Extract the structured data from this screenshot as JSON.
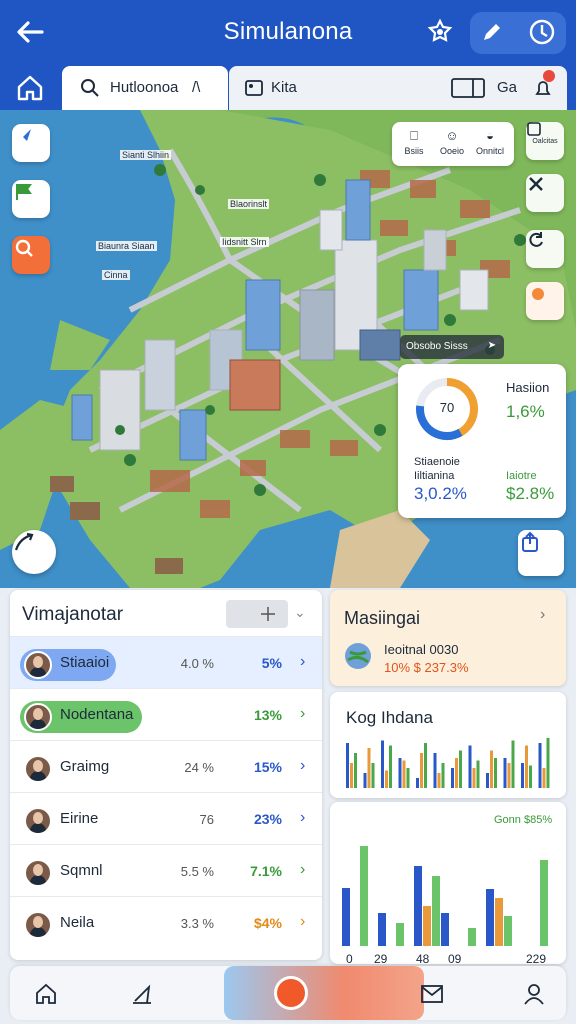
{
  "header": {
    "title": "Simulanona",
    "icons": [
      "back-arrow-icon",
      "settings-star-icon",
      "pencil-icon",
      "clock-icon"
    ]
  },
  "tabs": [
    {
      "label": "Hutloonoa",
      "icon": "search-icon",
      "suffix": "/\\"
    },
    {
      "label": "Kita",
      "icon": "image-icon",
      "right_label": "Ga"
    }
  ],
  "map": {
    "labels": [
      "Sianti Slhiin",
      "Blaorinslt",
      "Biaunra Siaan",
      "Iidsnitt Slrn",
      "Cinna"
    ],
    "toolbar": [
      {
        "label": "Bsiis",
        "icon": "bookmark-icon"
      },
      {
        "label": "Ooeio",
        "icon": "smile-icon"
      },
      {
        "label": "Onnitcl",
        "icon": "bell-icon"
      }
    ],
    "right_buttons": [
      "Oalcitas"
    ],
    "pin_label": "Obsobo Sisss",
    "stat_card": {
      "ring_value": "70",
      "top_label": "Hasiion",
      "top_value": "1,6%",
      "left_label": "Stiaenoie",
      "left_sub": "Iiltianina",
      "left_value": "3,0.2%",
      "right_label": "Iaiotre",
      "right_value": "$2.8%",
      "ring_fraction": 0.78
    }
  },
  "left_panel": {
    "title": "Vimajanotar",
    "rows": [
      {
        "name": "Stiaaioi",
        "v1": "4.0 %",
        "v2": "5%",
        "v2_color": "#2a58c8",
        "highlight": "blue"
      },
      {
        "name": "Nodentana",
        "v1": "",
        "v2": "13%",
        "v2_color": "#3a9a3a",
        "highlight": "green"
      },
      {
        "name": "Graimg",
        "v1": "24 %",
        "v2": "15%",
        "v2_color": "#2a58c8",
        "highlight": ""
      },
      {
        "name": "Eirine",
        "v1": "76",
        "v2": "23%",
        "v2_color": "#2a58c8",
        "highlight": ""
      },
      {
        "name": "Sqmnl",
        "v1": "5.5 %",
        "v2": "7.1%",
        "v2_color": "#3a9a3a",
        "highlight": ""
      },
      {
        "name": "Neila",
        "v1": "3.3 %",
        "v2": "$4%",
        "v2_color": "#e08a1a",
        "highlight": ""
      }
    ]
  },
  "right_panels": {
    "card1": {
      "title": "Masiingai",
      "line1": "Ieoitnal 0030",
      "line2": "10% $ 237.3%"
    },
    "card2": {
      "title": "Kog Ihdana"
    },
    "card3": {
      "top_label": "Gonn $85%",
      "xticks": [
        "0",
        "29",
        "48",
        "09",
        "229"
      ]
    }
  },
  "mini_chart": {
    "series": [
      {
        "color": "#2a58c8",
        "values": [
          0.9,
          0.3,
          0.95,
          0.6,
          0.2,
          0.7,
          0.4,
          0.85,
          0.3,
          0.6,
          0.5,
          0.9
        ]
      },
      {
        "color": "#e89a3a",
        "values": [
          0.5,
          0.8,
          0.35,
          0.55,
          0.7,
          0.3,
          0.6,
          0.4,
          0.75,
          0.5,
          0.85,
          0.4
        ]
      },
      {
        "color": "#4aa84a",
        "values": [
          0.7,
          0.5,
          0.85,
          0.4,
          0.9,
          0.5,
          0.75,
          0.55,
          0.6,
          0.95,
          0.45,
          1.0
        ]
      }
    ]
  },
  "bar_chart": {
    "groups": [
      {
        "blue": 0.58,
        "orange": 0.0,
        "green": 1.0,
        "blue2": 0.0
      },
      {
        "blue": 0.33,
        "orange": 0.0,
        "green": 0.23,
        "blue2": 0.0
      },
      {
        "blue": 0.8,
        "orange": 0.4,
        "green": 0.7,
        "blue2": 0.33
      },
      {
        "blue": 0.0,
        "orange": 0.0,
        "green": 0.18,
        "blue2": 0.0
      },
      {
        "blue": 0.57,
        "orange": 0.48,
        "green": 0.3,
        "blue2": 0.0
      },
      {
        "blue": 0.0,
        "orange": 0.0,
        "green": 0.86,
        "blue2": 0.0
      }
    ]
  },
  "bottom_nav": [
    "home-icon",
    "map-edit-icon",
    "play-icon",
    "mail-icon",
    "profile-icon"
  ],
  "colors": {
    "primary": "#1f56c4",
    "water": "#3f8fc9",
    "land": "#7fb85a",
    "accent": "#f05a2a"
  }
}
